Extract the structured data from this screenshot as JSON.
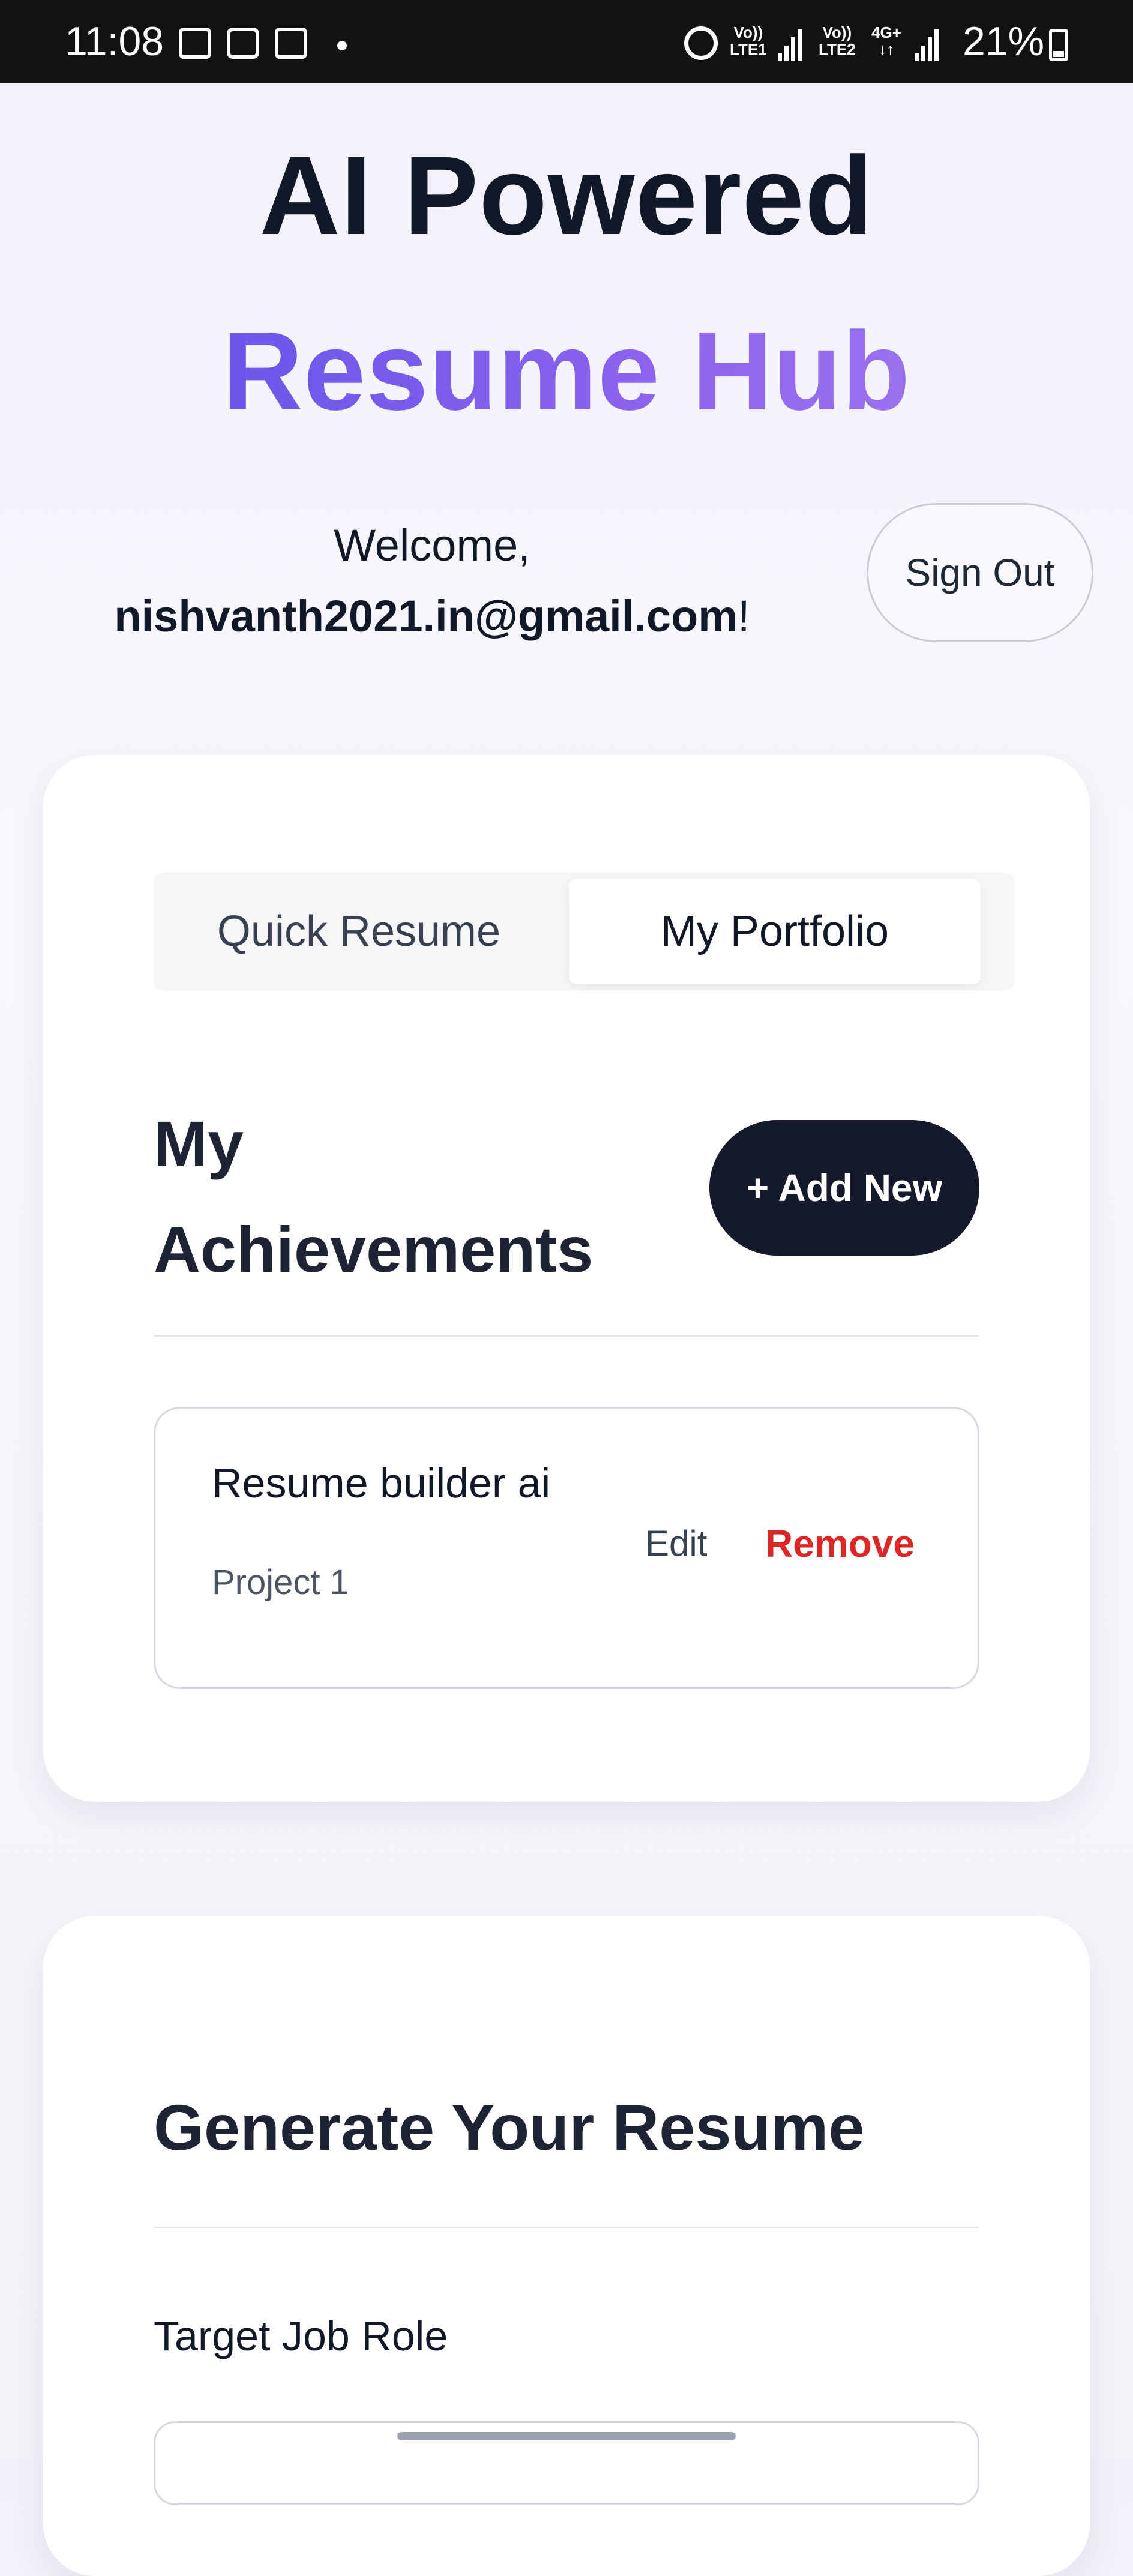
{
  "status_bar": {
    "time": "11:08",
    "net1": "Vo))\nLTE1",
    "net2": "Vo))\nLTE2",
    "net3": "4G+",
    "battery": "21%"
  },
  "header": {
    "title_line1": "AI Powered",
    "title_line2": "Resume Hub",
    "welcome_prefix": "Welcome,",
    "email": "nishvanth2021.in@gmail.com",
    "welcome_suffix": "!",
    "signout_label": "Sign Out"
  },
  "tabs": {
    "quick": "Quick Resume",
    "portfolio": "My Portfolio",
    "active": "My Portfolio"
  },
  "achievements": {
    "title": "My Achievements",
    "add_button": "+ Add New",
    "items": [
      {
        "name": "Resume builder ai",
        "subtitle": "Project 1",
        "edit_label": "Edit",
        "remove_label": "Remove"
      }
    ]
  },
  "generate": {
    "title": "Generate Your Resume",
    "target_label": "Target Job Role",
    "target_value": ""
  },
  "colors": {
    "accent_start": "#5b50e8",
    "accent_end": "#a87cf0",
    "dark_button": "#141a2b",
    "remove_red": "#dc2626"
  }
}
